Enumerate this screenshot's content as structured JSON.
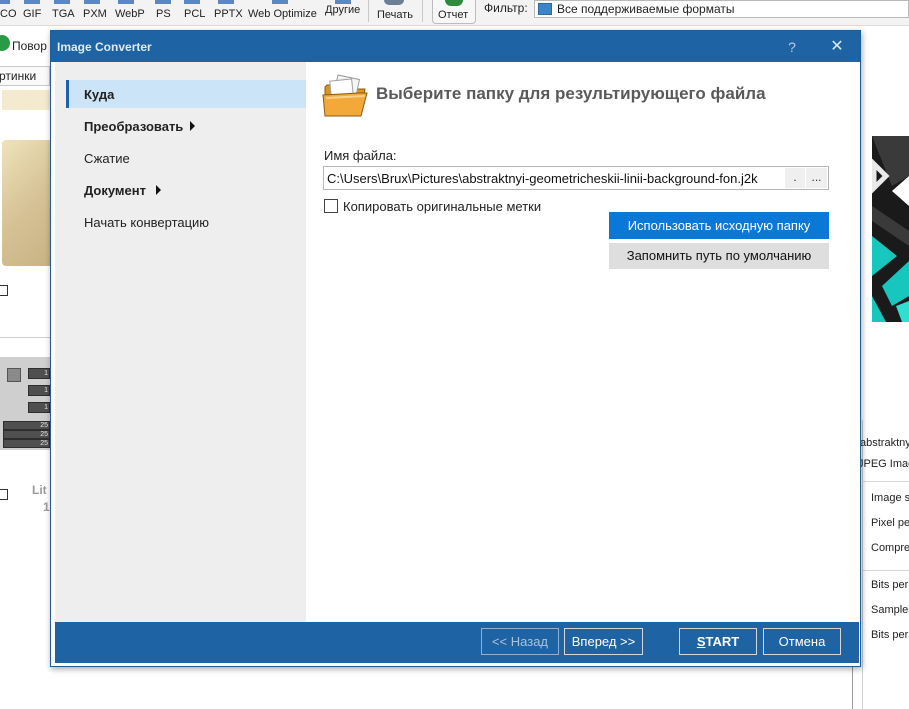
{
  "toolbar": {
    "formats": [
      "CO",
      "GIF",
      "TGA",
      "PXM",
      "WebP",
      "PS",
      "PCL",
      "PPTX",
      "Web Optimize",
      "Другие"
    ],
    "print_label": "Печать",
    "report_label": "Отчет",
    "filter_label": "Фильтр:",
    "filter_value": "Все поддерживаемые форматы"
  },
  "background": {
    "rotate_label": "Повор",
    "pictures_tab": "ртинки",
    "caption_1": "Lit",
    "caption_2": "1",
    "thumb_values": [
      "1",
      "1",
      "1",
      "25",
      "25",
      "25"
    ]
  },
  "info_panel": {
    "file_name": "abstraktny",
    "file_type": "JPEG Imag",
    "rows": [
      "Image s",
      "Pixel pe",
      "Compre",
      "Bits per",
      "Samples",
      "Bits per"
    ]
  },
  "dialog": {
    "title": "Image Converter",
    "help": "?",
    "close": "✕",
    "heading": "Выберите папку для результирующего файла",
    "filename_label": "Имя файла:",
    "filename_value": "C:\\Users\\Brux\\Pictures\\abstraktnyi-geometricheskii-linii-background-fon.j2k",
    "browse_dot": ".",
    "browse_ellipsis": "...",
    "copy_tags_label": "Копировать оригинальные метки",
    "copy_tags_checked": false,
    "use_source_folder": "Использовать исходную папку",
    "remember_default": "Запомнить путь по умолчанию",
    "nav": [
      {
        "label": "Куда",
        "bold": true,
        "active": true,
        "arrow": false
      },
      {
        "label": "Преобразовать",
        "bold": true,
        "active": false,
        "arrow": true
      },
      {
        "label": "Сжатие",
        "bold": false,
        "active": false,
        "arrow": false
      },
      {
        "label": "Документ",
        "bold": true,
        "active": false,
        "arrow": true
      },
      {
        "label": "Начать конвертацию",
        "bold": false,
        "active": false,
        "arrow": false
      }
    ],
    "footer": {
      "back": "<< Назад",
      "next": "Вперед >>",
      "start": "START",
      "cancel": "Отмена"
    }
  },
  "colors": {
    "accent": "#1e63a4",
    "primary_button": "#0a78d7",
    "nav_active": "#cce4f7"
  }
}
